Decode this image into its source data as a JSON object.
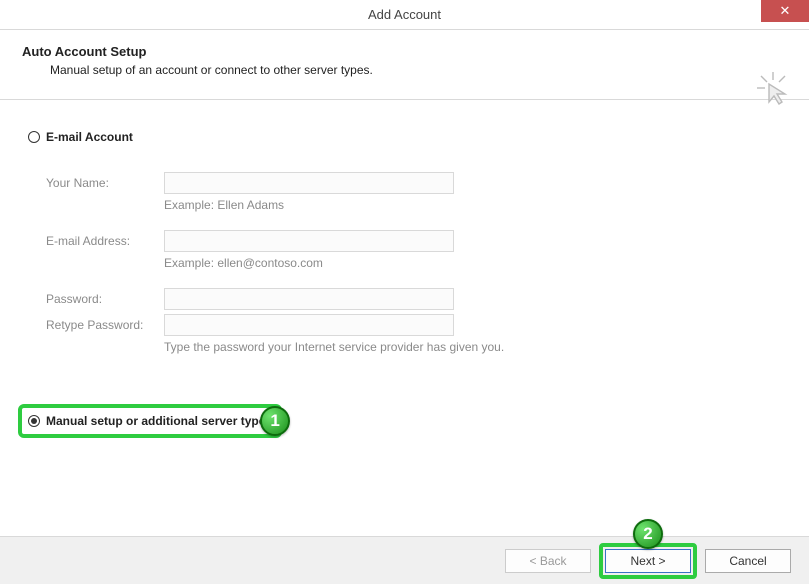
{
  "title": "Add Account",
  "header": {
    "heading": "Auto Account Setup",
    "subheading": "Manual setup of an account or connect to other server types."
  },
  "options": {
    "email_account_label": "E-mail Account",
    "manual_setup_label": "Manual setup or additional server types"
  },
  "form": {
    "your_name_label": "Your Name:",
    "your_name_hint": "Example: Ellen Adams",
    "email_label": "E-mail Address:",
    "email_hint": "Example: ellen@contoso.com",
    "password_label": "Password:",
    "retype_password_label": "Retype Password:",
    "password_hint": "Type the password your Internet service provider has given you."
  },
  "buttons": {
    "back": "< Back",
    "next": "Next >",
    "cancel": "Cancel"
  },
  "callouts": {
    "one": "1",
    "two": "2"
  }
}
